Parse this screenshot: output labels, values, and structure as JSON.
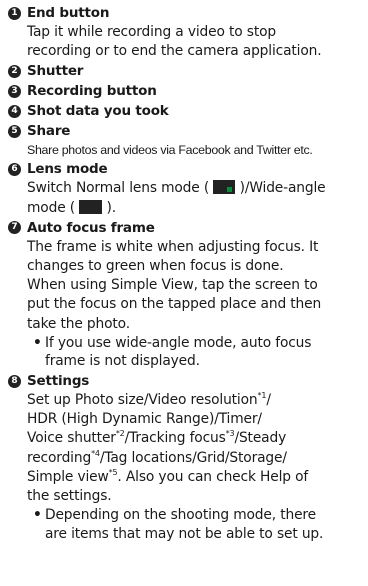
{
  "items": [
    {
      "number": "1",
      "title": "End button",
      "lines": [
        "Tap it while recording a video to stop",
        "recording or to end the camera application."
      ]
    },
    {
      "number": "2",
      "title": "Shutter"
    },
    {
      "number": "3",
      "title": "Recording button"
    },
    {
      "number": "4",
      "title": "Shot data you took"
    },
    {
      "number": "5",
      "title": "Share",
      "lines": [
        "Share photos and videos via Facebook and Twitter etc."
      ]
    },
    {
      "number": "6",
      "title": "Lens mode",
      "line1_before": "Switch Normal lens mode (",
      "line1_after": ")/Wide-angle",
      "line2_before": "mode (",
      "line2_after": ").",
      "icons": [
        "normal-lens-mode-icon",
        "wide-angle-mode-icon"
      ]
    },
    {
      "number": "7",
      "title": "Auto focus frame",
      "lines": [
        "The frame is white when adjusting focus. It",
        "changes to green when focus is done.",
        "When using Simple View, tap the screen to",
        "put the focus on the tapped place and then",
        "take the photo."
      ],
      "bullet_lines": [
        "If you use wide-angle mode, auto focus",
        "frame is not displayed."
      ]
    },
    {
      "number": "8",
      "title": "Settings",
      "l1a": "Set up Photo size/Video resolution",
      "l1n": "*1",
      "l1b": "/",
      "l2": "HDR (High Dynamic Range)/Timer/",
      "l3a": "Voice shutter",
      "l3n": "*2",
      "l3b": "/Tracking focus",
      "l3n2": "*3",
      "l3c": "/Steady",
      "l4a": "recording",
      "l4n": "*4",
      "l4b": "/Tag locations/Grid/Storage/",
      "l5a": "Simple view",
      "l5n": "*5",
      "l5b": ". Also you can check Help of",
      "l6": "the settings.",
      "bullet_lines": [
        "Depending on the shooting mode, there",
        "are items that may not be able to set up."
      ]
    }
  ],
  "colors": {
    "text": "#1a1a1a",
    "badge": "#222222",
    "green_indicator": "#0a8a3a"
  }
}
